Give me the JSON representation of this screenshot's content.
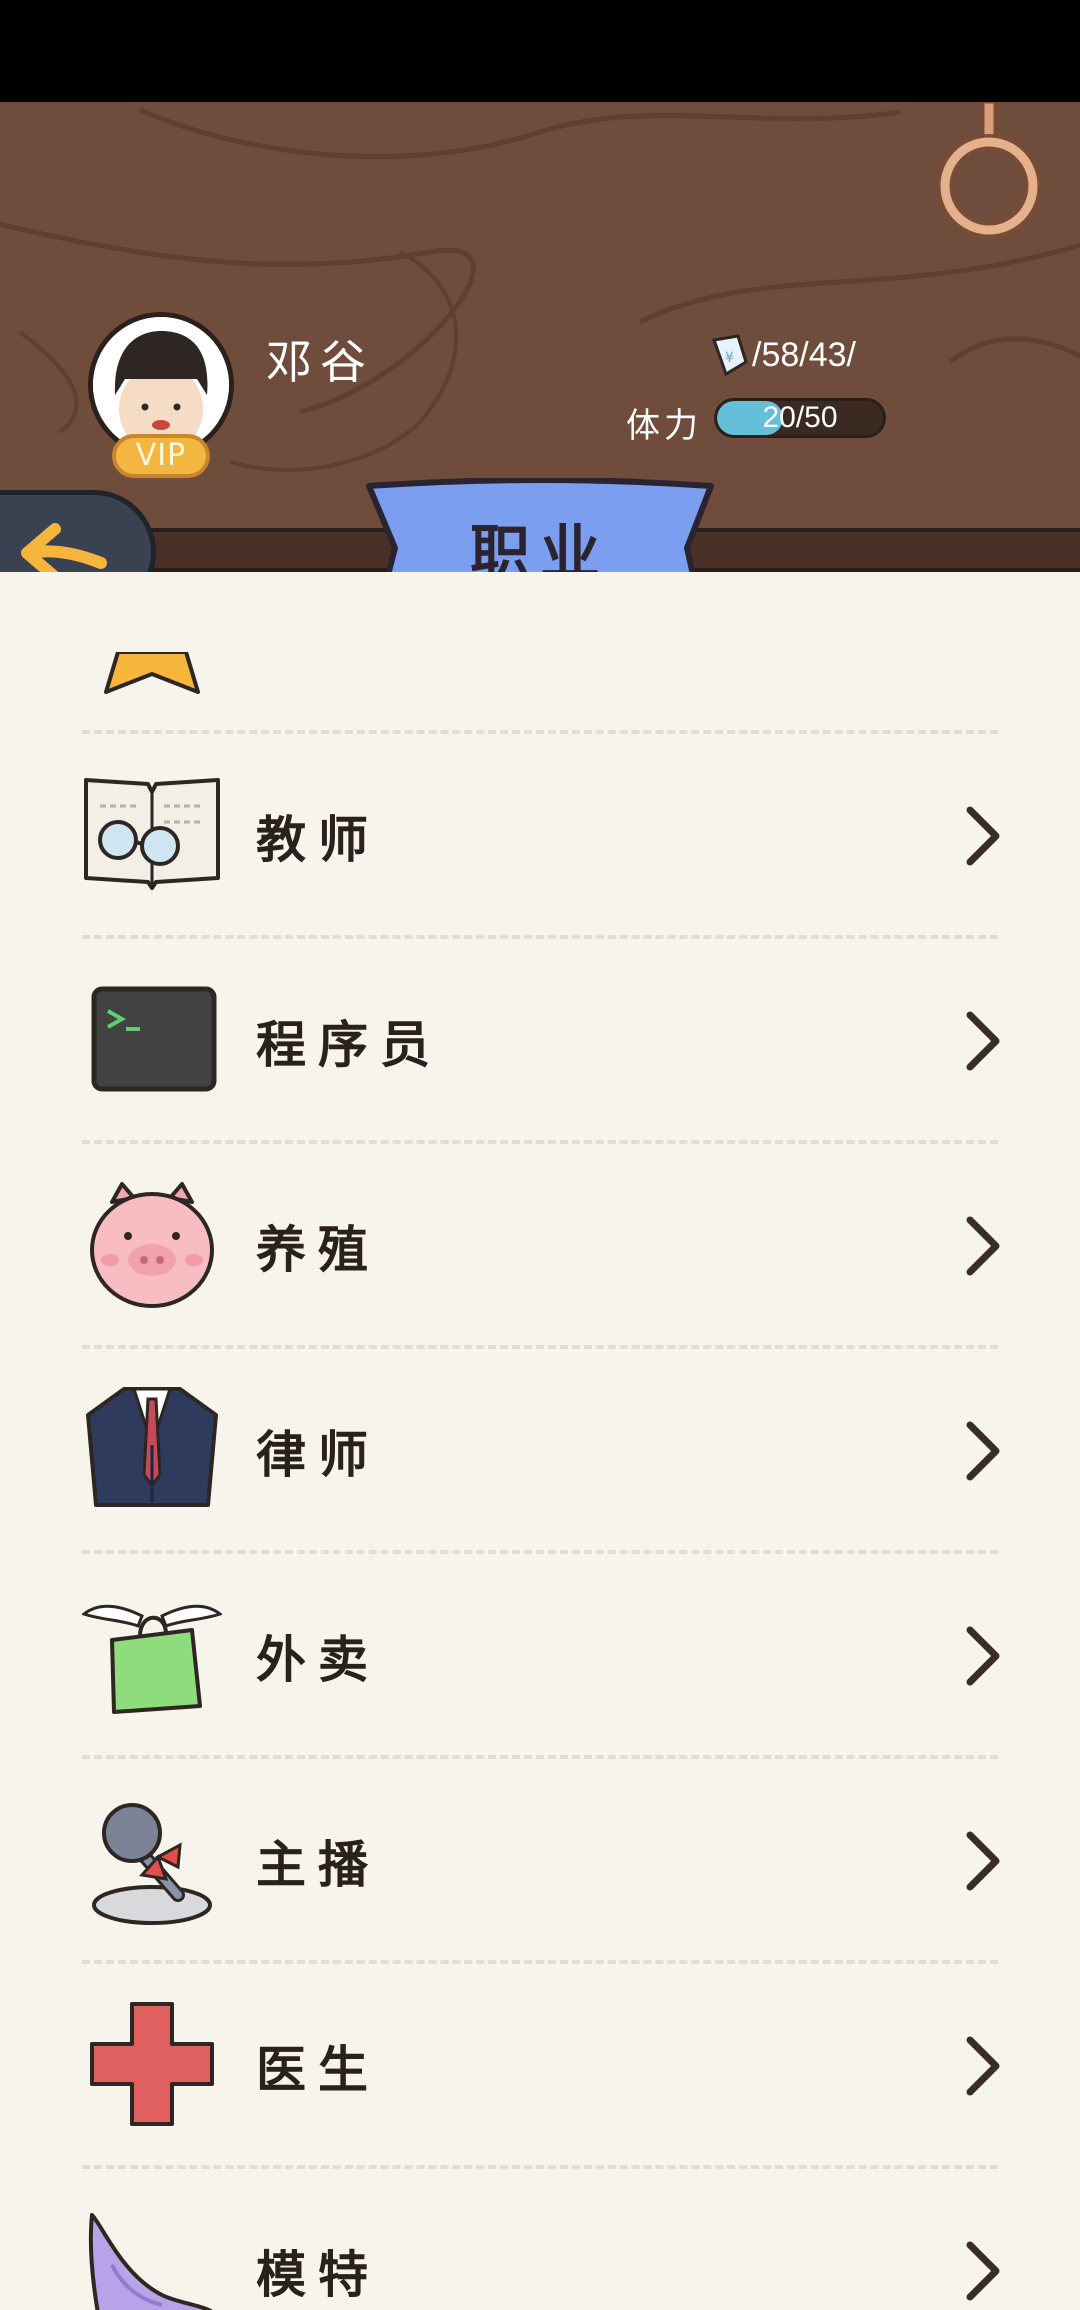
{
  "header": {
    "player_name": "邓谷",
    "vip_label": "VIP",
    "ticket_value": "158143",
    "ticket_display": "/58/43/",
    "stamina_label": "体力",
    "stamina_text": "20/50",
    "stamina_fraction": 0.4
  },
  "banner": {
    "title": "职业"
  },
  "careers": [
    {
      "label": "",
      "icon": "star-icon"
    },
    {
      "label": "教师",
      "icon": "book-glasses-icon"
    },
    {
      "label": "程序员",
      "icon": "terminal-icon"
    },
    {
      "label": "养殖",
      "icon": "pig-icon"
    },
    {
      "label": "律师",
      "icon": "suit-icon"
    },
    {
      "label": "外卖",
      "icon": "delivery-bag-icon"
    },
    {
      "label": "主播",
      "icon": "microphone-icon"
    },
    {
      "label": "医生",
      "icon": "medical-cross-icon"
    },
    {
      "label": "模特",
      "icon": "high-heel-icon"
    }
  ],
  "colors": {
    "wood": "#6f4c3b",
    "banner": "#7b9ef0",
    "list_bg": "#f7f4ec",
    "accent_arrow": "#f6b63c",
    "stamina": "#66bfd9"
  }
}
